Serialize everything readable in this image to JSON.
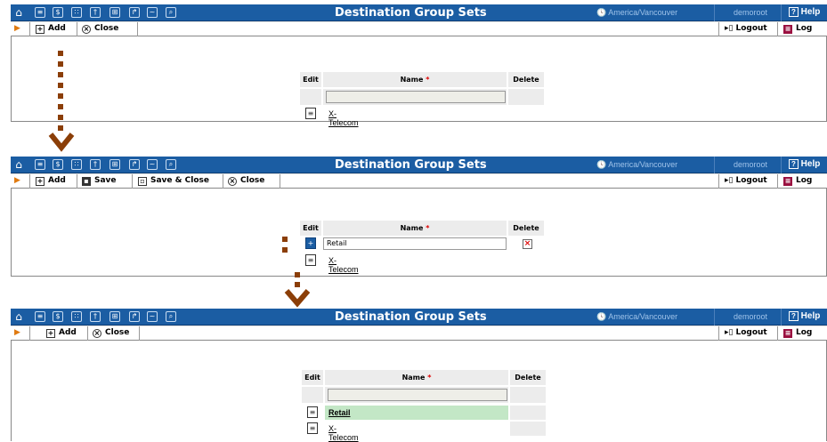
{
  "colors": {
    "titlebar": "#1b5da3",
    "accent": "#8b3e07",
    "highlight": "#c3e7c6"
  },
  "panels": [
    {
      "title": "Destination Group Sets",
      "timezone": "America/Vancouver",
      "user": "demoroot",
      "help": "Help",
      "toolbar": {
        "add": "Add",
        "close": "Close",
        "logout": "Logout",
        "log": "Log"
      },
      "table": {
        "headers": {
          "edit": "Edit",
          "name": "Name",
          "required": "*",
          "delete": "Delete"
        },
        "rows": [
          "X-Telecom"
        ]
      }
    },
    {
      "title": "Destination Group Sets",
      "timezone": "America/Vancouver",
      "user": "demoroot",
      "help": "Help",
      "toolbar": {
        "add": "Add",
        "save": "Save",
        "save_close": "Save & Close",
        "close": "Close",
        "logout": "Logout",
        "log": "Log"
      },
      "table": {
        "headers": {
          "edit": "Edit",
          "name": "Name",
          "required": "*",
          "delete": "Delete"
        },
        "new_value": "Retail",
        "rows": [
          "X-Telecom"
        ]
      }
    },
    {
      "title": "Destination Group Sets",
      "timezone": "America/Vancouver",
      "user": "demoroot",
      "help": "Help",
      "toolbar": {
        "add": "Add",
        "close": "Close",
        "logout": "Logout",
        "log": "Log"
      },
      "table": {
        "headers": {
          "edit": "Edit",
          "name": "Name",
          "required": "*",
          "delete": "Delete"
        },
        "rows": [
          "Retail",
          "X-Telecom"
        ]
      }
    }
  ]
}
